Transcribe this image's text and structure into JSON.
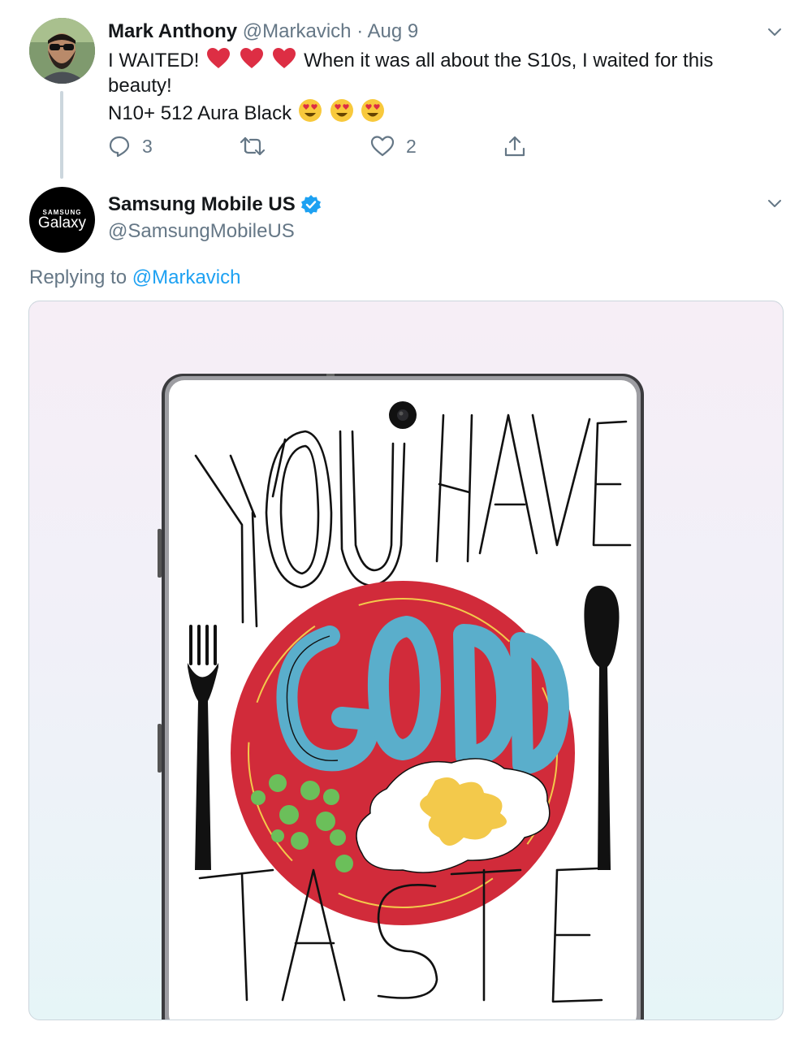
{
  "tweet1": {
    "name": "Mark Anthony",
    "handle": "@Markavich",
    "separator": "·",
    "date": "Aug 9",
    "text_part1": "I WAITED!",
    "text_part2": "When it was all about the S10s, I waited for this",
    "text_line2": "beauty!",
    "text_line3": "N10+ 512 Aura Black",
    "emojis": [
      "red-heart",
      "red-heart",
      "red-heart",
      "heart-eyes",
      "heart-eyes",
      "heart-eyes"
    ],
    "reply_count": "3",
    "retweet_count": "",
    "like_count": "2"
  },
  "tweet2": {
    "name": "Samsung Mobile US",
    "handle": "@SamsungMobileUS",
    "avatar_brand_small": "SAMSUNG",
    "avatar_brand_big": "Galaxy",
    "verified": true,
    "replying_label": "Replying to",
    "replying_handle": "@Markavich"
  },
  "media": {
    "lettering": [
      "YOU HAVE",
      "GOOD",
      "TASTE"
    ]
  },
  "colors": {
    "link": "#1da1f2",
    "muted": "#657786",
    "heart": "#e0245e",
    "plate": "#d12b3a",
    "good_letters": "#5aaecb",
    "peas": "#6bbf5a",
    "yolk": "#f3c94b"
  },
  "icons": [
    "chevron-down-icon",
    "reply-icon",
    "retweet-icon",
    "like-icon",
    "share-icon",
    "verified-badge-icon"
  ]
}
